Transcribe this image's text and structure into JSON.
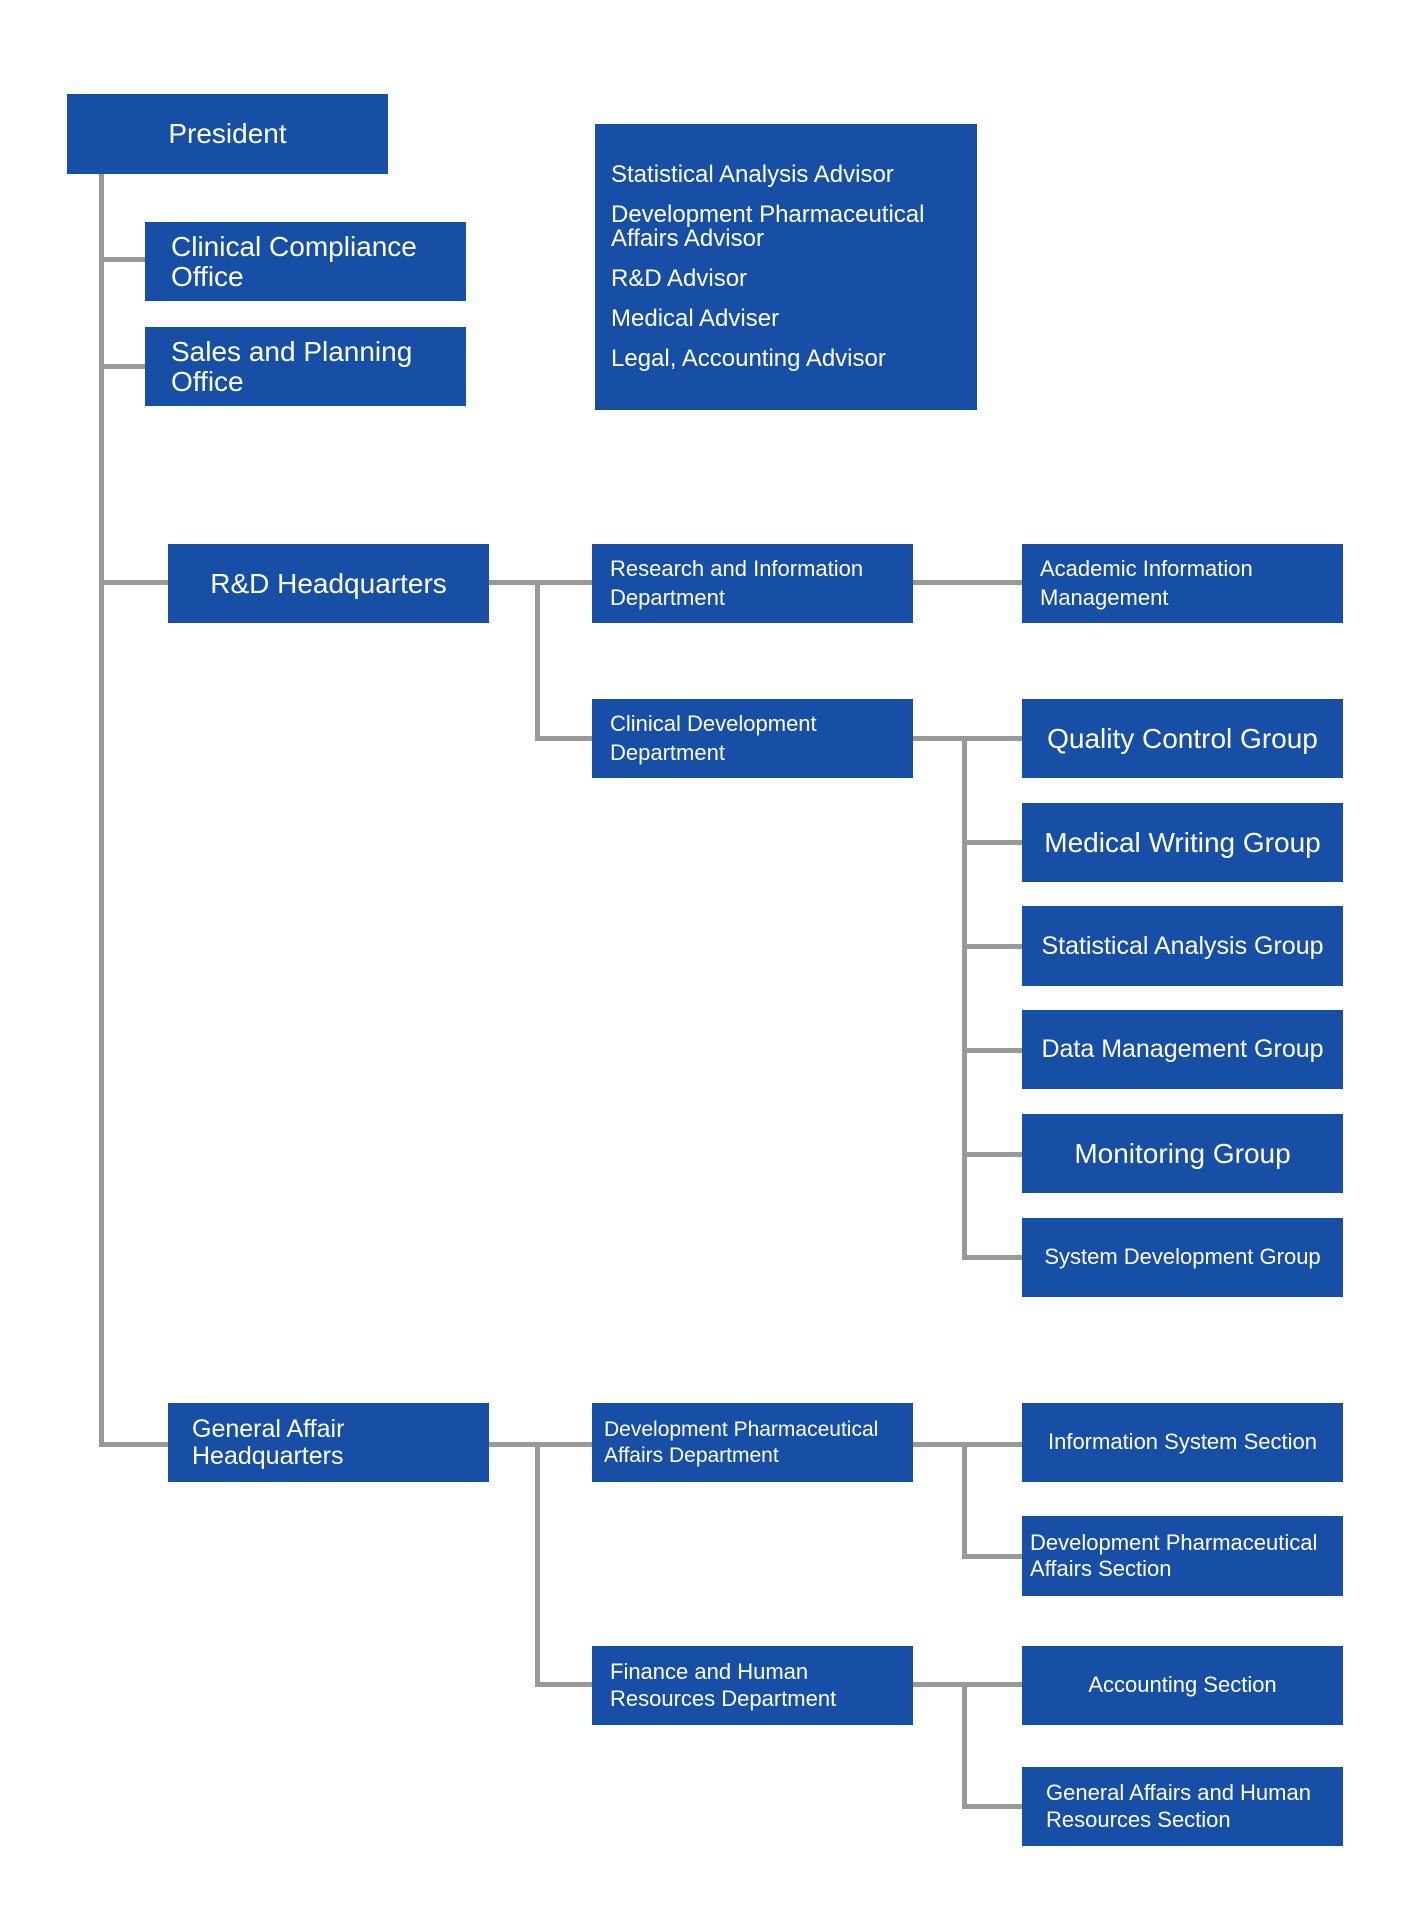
{
  "colors": {
    "box": "#174ea6",
    "line": "#999999",
    "text": "#ffffff"
  },
  "president": "President",
  "offices": [
    "Clinical Compliance Office",
    "Sales and Planning Office"
  ],
  "advisors": [
    "Statistical Analysis Advisor",
    "Development Pharmaceutical Affairs Advisor",
    "R&D Advisor",
    "Medical Adviser",
    "Legal, Accounting Advisor"
  ],
  "rd": {
    "hq": "R&D Headquarters",
    "research_dept": "Research and Information Department",
    "academic": "Academic Information Management",
    "clinical_dept": "Clinical Development Department",
    "groups": [
      "Quality Control Group",
      "Medical Writing Group",
      "Statistical Analysis Group",
      "Data Management Group",
      "Monitoring Group",
      "System Development Group"
    ]
  },
  "ga": {
    "hq": "General Affair Headquarters",
    "devpharm_dept": "Development Pharmaceutical Affairs Department",
    "devpharm_sections": [
      "Information System Section",
      "Development Pharmaceutical Affairs Section"
    ],
    "finance_dept": "Finance and Human Resources Department",
    "finance_sections": [
      "Accounting Section",
      "General Affairs and Human Resources Section"
    ]
  }
}
